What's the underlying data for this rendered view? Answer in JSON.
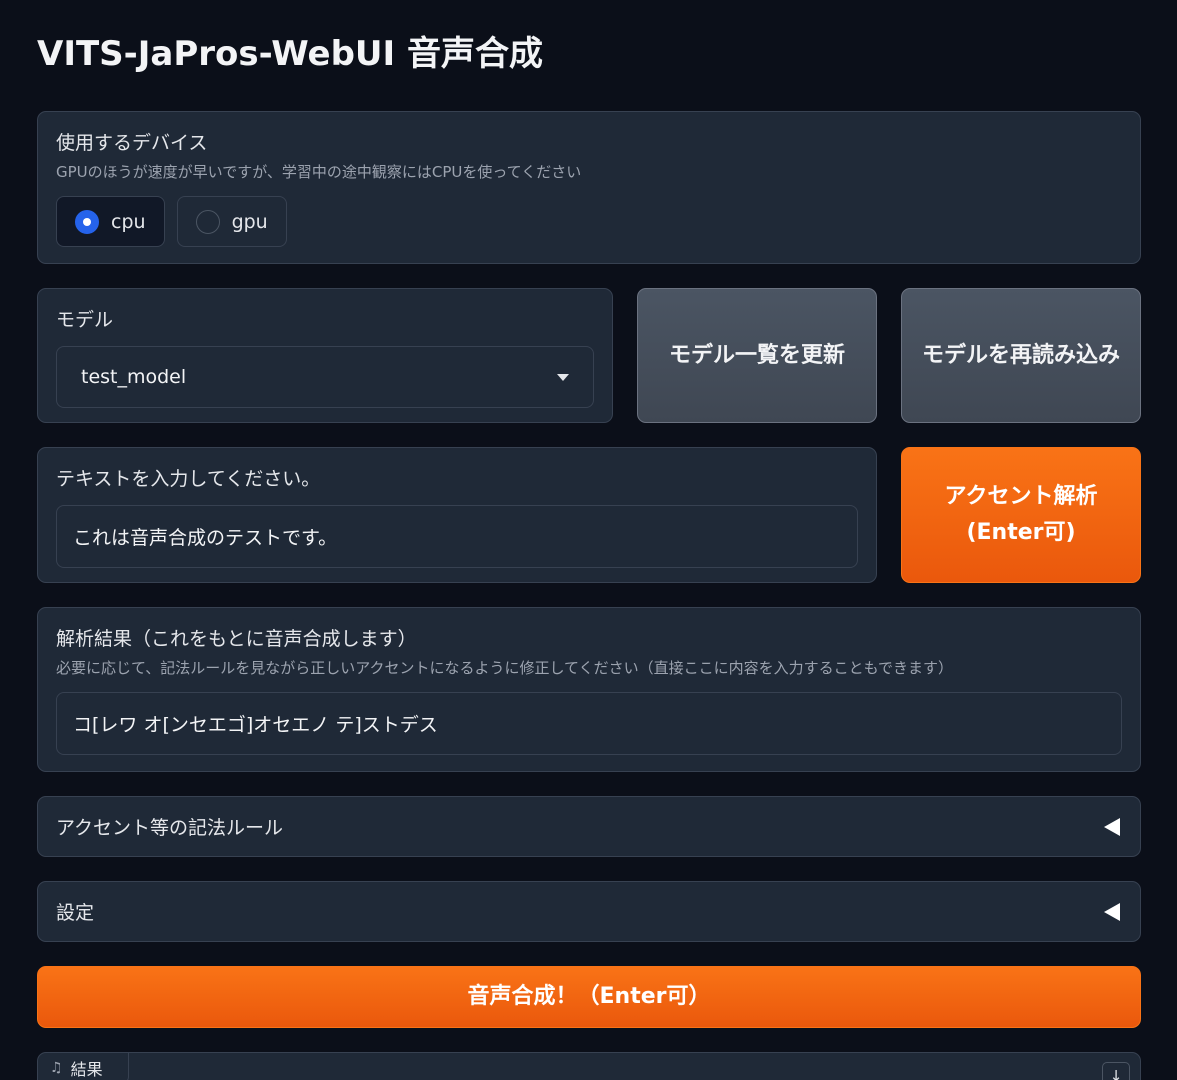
{
  "title": "VITS-JaPros-WebUI 音声合成",
  "device": {
    "label": "使用するデバイス",
    "info": "GPUのほうが速度が早いですが、学習中の途中観察にはCPUを使ってください",
    "options": [
      {
        "label": "cpu",
        "selected": true
      },
      {
        "label": "gpu",
        "selected": false
      }
    ]
  },
  "model": {
    "label": "モデル",
    "value": "test_model"
  },
  "buttons": {
    "refresh": "モデル一覧を更新",
    "reload": "モデルを再読み込み",
    "accent": "アクセント解析(Enter可)",
    "synthesize": "音声合成！（Enter可）"
  },
  "text_input": {
    "label": "テキストを入力してください。",
    "value": "これは音声合成のテストです。"
  },
  "analysis": {
    "label": "解析結果（これをもとに音声合成します）",
    "info": "必要に応じて、記法ルールを見ながら正しいアクセントになるように修正してください（直接ここに内容を入力することもできます）",
    "value": "コ[レワ オ[ンセエゴ]オセエノ テ]ストデス"
  },
  "accordions": {
    "rules": "アクセント等の記法ルール",
    "settings": "設定"
  },
  "output": {
    "label": "結果",
    "icon": "music-note-icon",
    "download_icon": "download-icon"
  },
  "colors": {
    "background": "#0b0f19",
    "panel": "#1f2937",
    "accent": "#f97316",
    "radio_selected": "#2563eb"
  }
}
